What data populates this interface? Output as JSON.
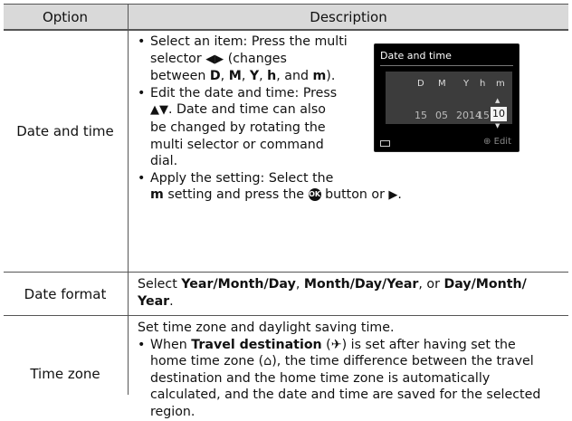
{
  "header": {
    "col1": "Option",
    "col2": "Description"
  },
  "rows": [
    {
      "option": "Date and time",
      "b1_pre": "Select an item: Press the multi",
      "b1_mid": "selector",
      "b1_glyph": "◀▶",
      "b1_post": "(changes",
      "b1_l3a": "between ",
      "b1_D": "D",
      "b1_M": "M",
      "b1_Y": "Y",
      "b1_h": "h",
      "b1_m": "m",
      "b2_l1": "Edit the date and time: Press",
      "b2_glyph": "▲▼",
      "b2_l2": ". Date and time can also",
      "b2_l3": "be changed by rotating the",
      "b2_l4": "multi selector or command",
      "b2_l5": "dial.",
      "b3_l1": "Apply the setting: Select the",
      "b3_m": "m",
      "b3_l2": "setting and press the",
      "b3_ok": "OK",
      "b3_l3": "button or",
      "b3_arrow": "▶",
      "screen": {
        "title": "Date and time",
        "labels": [
          "D",
          "M",
          "Y",
          "h",
          "m"
        ],
        "values": [
          "15",
          "05",
          "2014",
          "15",
          "10"
        ],
        "edit": "Edit",
        "edit_icon": "dial-icon"
      }
    },
    {
      "option": "Date format",
      "p1": "Select ",
      "f1": "Year/Month/Day",
      "p2": ", ",
      "f2": "Month/Day/Year",
      "p3": ", or ",
      "f3a": "Day/Month/",
      "f3b": "Year",
      "p4": "."
    },
    {
      "option": "Time zone",
      "intro": "Set time zone and daylight saving time.",
      "l1a": "When ",
      "l1b": "Travel destination",
      "l1c": " (",
      "l1d": ") is set after having set the",
      "l2a": "home time zone (",
      "l2b": "), the time difference between the travel",
      "l3": "destination and the home time zone is automatically",
      "l4": "calculated, and the date and time are saved for the selected",
      "l5": "region."
    }
  ]
}
